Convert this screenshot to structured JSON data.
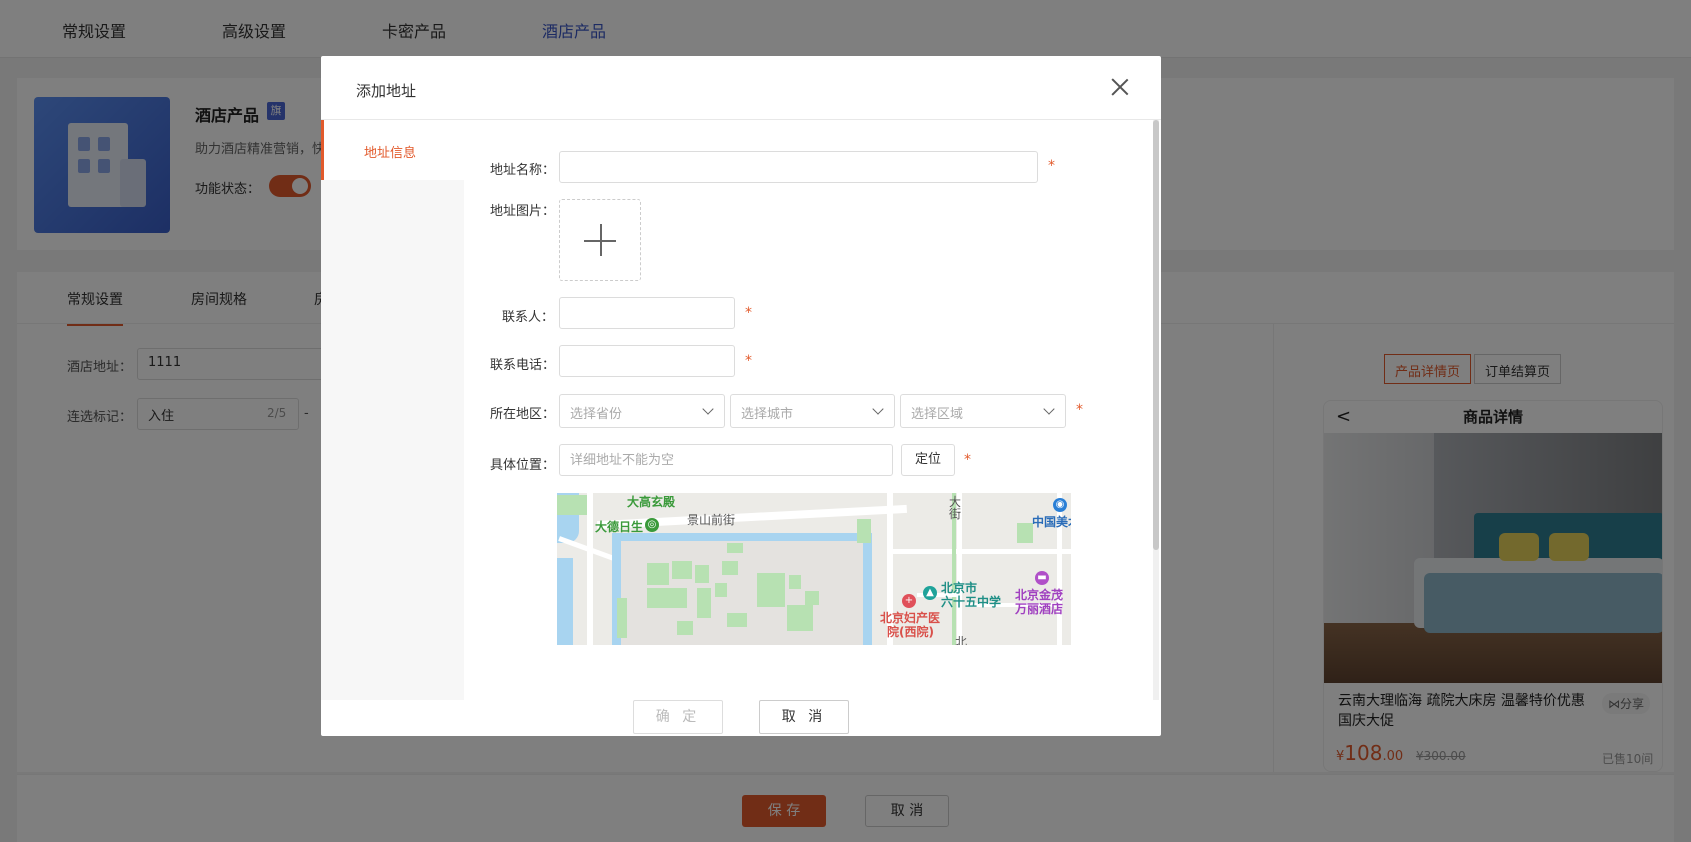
{
  "top_tabs": [
    "常规设置",
    "高级设置",
    "卡密产品",
    "酒店产品"
  ],
  "product": {
    "name": "酒店产品",
    "badge": "旗",
    "desc": "助力酒店精准营销，快",
    "status_label": "功能状态："
  },
  "sub_tabs": [
    "常规设置",
    "房间规格",
    "房"
  ],
  "bg_form": {
    "address_label": "酒店地址：",
    "address_value": "1111",
    "mark_label": "连选标记：",
    "mark_value": "入住",
    "mark_counter": "2/5",
    "dash": "-"
  },
  "preview": {
    "tabs": [
      "产品详情页",
      "订单结算页"
    ],
    "header": "商品详情",
    "back": "<",
    "title": "云南大理临海 疏院大床房 温馨特价优惠 国庆大促",
    "share": "分享",
    "price_symbol": "¥",
    "price_int": "108",
    "price_dec": ".00",
    "orig_price": "¥300.00",
    "sold": "已售10间"
  },
  "bottom": {
    "save": "保 存",
    "cancel": "取 消"
  },
  "modal": {
    "title": "添加地址",
    "side_item": "地址信息",
    "fields": {
      "name_label": "地址名称：",
      "image_label": "地址图片：",
      "contact_label": "联系人：",
      "phone_label": "联系电话：",
      "region_label": "所在地区：",
      "location_label": "具体位置：",
      "required_mark": "*"
    },
    "province_placeholder": "选择省份",
    "city_placeholder": "选择城市",
    "district_placeholder": "选择区域",
    "location_placeholder": "详细地址不能为空",
    "locate_button": "定位",
    "ok": "确 定",
    "cancel": "取 消"
  },
  "map_labels": {
    "p1": "大高玄殿",
    "p2": "大德日生",
    "p3": "景山前街",
    "p4": "大",
    "p5": "街",
    "p6": "中国美术",
    "p7": "北京市",
    "p8": "六十五中学",
    "p9": "北京妇产医",
    "p10": "院(西院)",
    "p11": "北京金茂",
    "p12": "万丽酒店",
    "p13": "北"
  },
  "colors": {
    "accent": "#e25a2c",
    "nav_active": "#3a57c7"
  }
}
